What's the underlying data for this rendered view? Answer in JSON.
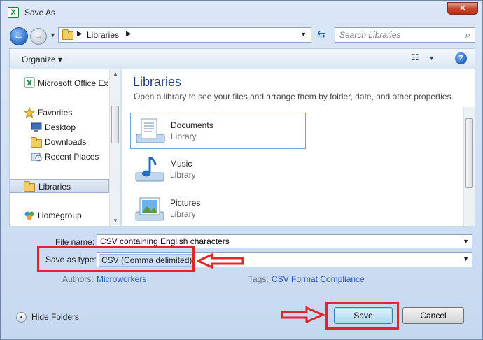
{
  "window": {
    "title": "Save As",
    "close_glyph": "✕",
    "app_icon_letter": "X"
  },
  "address": {
    "crumb": "Libraries",
    "separator": "▶"
  },
  "search": {
    "placeholder": "Search Libraries"
  },
  "toolbar": {
    "organize_label": "Organize ▾"
  },
  "nav": {
    "items": [
      {
        "label": "Microsoft Office Ex",
        "icon": "excel-icon"
      },
      {
        "label": "Favorites",
        "icon": "star-icon"
      },
      {
        "label": "Desktop",
        "icon": "desktop-icon"
      },
      {
        "label": "Downloads",
        "icon": "downloads-folder-icon"
      },
      {
        "label": "Recent Places",
        "icon": "recent-places-icon"
      },
      {
        "label": "Libraries",
        "icon": "libraries-icon",
        "selected": true
      },
      {
        "label": "Homegroup",
        "icon": "homegroup-icon"
      }
    ]
  },
  "content": {
    "title": "Libraries",
    "subtitle": "Open a library to see your files and arrange them by folder, date, and other properties.",
    "libraries": [
      {
        "name": "Documents",
        "kind": "Library",
        "icon": "documents-library-icon"
      },
      {
        "name": "Music",
        "kind": "Library",
        "icon": "music-library-icon"
      },
      {
        "name": "Pictures",
        "kind": "Library",
        "icon": "pictures-library-icon"
      }
    ]
  },
  "form": {
    "file_name_label": "File name:",
    "file_name_value": "CSV containing English characters",
    "save_type_label": "Save as type:",
    "save_type_value": "CSV (Comma delimited)",
    "authors_label": "Authors:",
    "authors_value": "Microworkers",
    "tags_label": "Tags:",
    "tags_value": "CSV Format Compliance"
  },
  "footer": {
    "hide_folders_label": "Hide Folders",
    "save_label": "Save",
    "cancel_label": "Cancel"
  },
  "annotations": {
    "color": "#e0262a"
  }
}
